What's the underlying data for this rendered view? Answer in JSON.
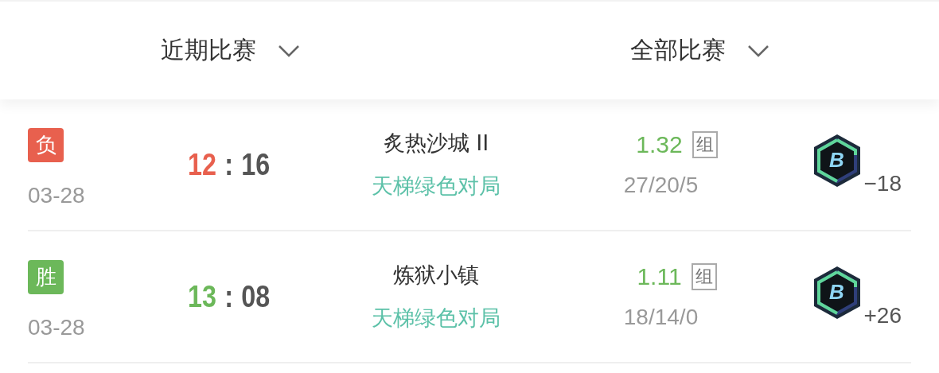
{
  "filters": [
    {
      "label": "近期比赛"
    },
    {
      "label": "全部比赛"
    }
  ],
  "matches": [
    {
      "result": "负",
      "kind": "loss",
      "date": "03-28",
      "score_own": "12",
      "separator": ":",
      "score_opp": "16",
      "map": "炙热沙城 II",
      "mode": "天梯绿色对局",
      "rating": "1.32",
      "rating_tag": "组",
      "kda": "27/20/5",
      "rank": "B",
      "delta": "−18"
    },
    {
      "result": "胜",
      "kind": "win",
      "date": "03-28",
      "score_own": "13",
      "separator": ":",
      "score_opp": "08",
      "map": "炼狱小镇",
      "mode": "天梯绿色对局",
      "rating": "1.11",
      "rating_tag": "组",
      "kda": "18/14/0",
      "rank": "B",
      "delta": "+26"
    }
  ]
}
